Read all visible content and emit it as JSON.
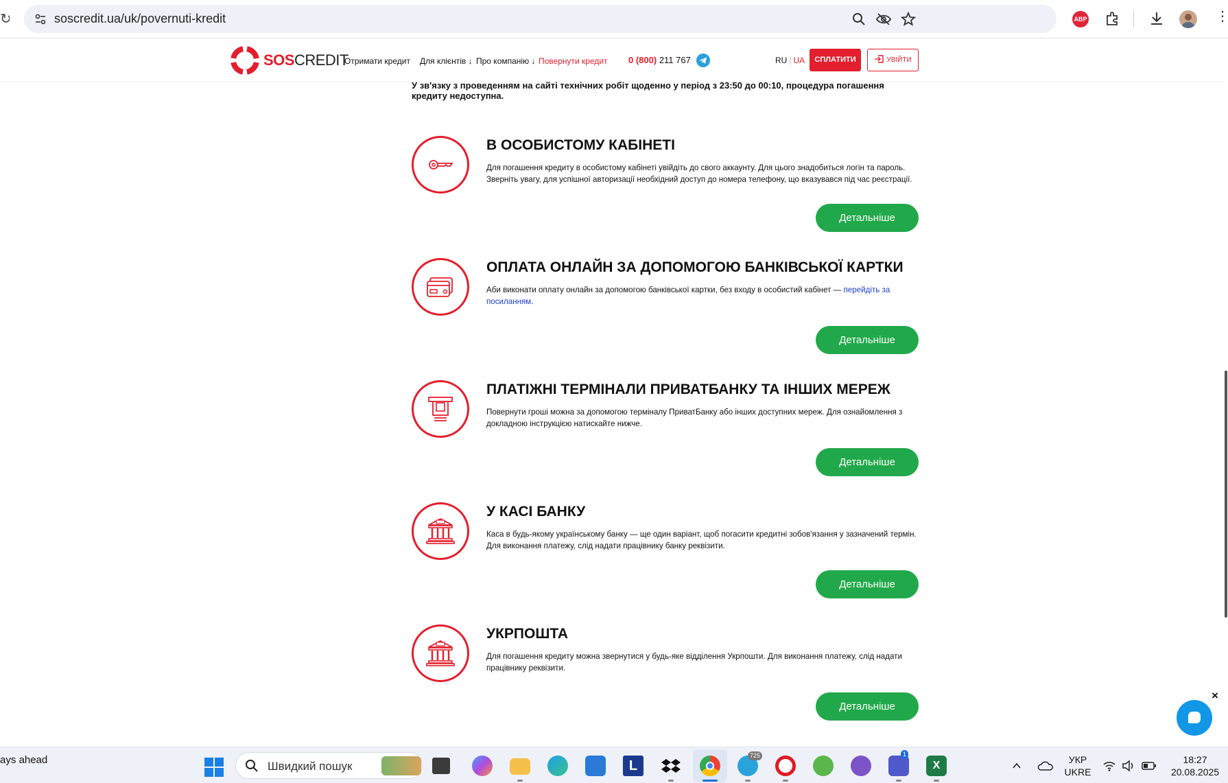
{
  "browser": {
    "url": "soscredit.ua/uk/povernuti-kredit",
    "extension_badge": "ABP"
  },
  "header": {
    "logo_sos": "SOS",
    "logo_credit": "CREDIT",
    "nav": {
      "get_credit": "Отримати кредит",
      "for_clients": "Для клієнтів ↓",
      "about": "Про компанію ↓",
      "return_credit": "Повернути кредит"
    },
    "phone_prefix": "0 (800)",
    "phone_number": " 211 767",
    "lang_ru": "RU",
    "lang_sep": "|",
    "lang_ua": "UA",
    "pay_button": "СПЛАТИТИ",
    "login_button": "УВІЙТИ"
  },
  "notice": "У зв'язку з проведенням на сайті технічних робіт щоденно у період з 23:50 до 00:10, процедура погашення кредиту недоступна.",
  "sections": [
    {
      "icon": "key-icon",
      "title": "В ОСОБИСТОМУ КАБІНЕТІ",
      "text": "Для погашення кредиту в особистому кабінеті увійдіть до свого аккаунту. Для цього знадобиться логін та пароль. Зверніть увагу, для успішної авторизації необхідний доступ до номера телефону, що вказувався під час реєстрації.",
      "button": "Детальніше"
    },
    {
      "icon": "card-icon",
      "title": "ОПЛАТА ОНЛАЙН ЗА ДОПОМОГОЮ БАНКІВСЬКОЇ КАРТКИ",
      "text": "Аби виконати оплату онлайн за допомогою банківської картки, без входу в особистий кабінет — ",
      "link": "перейдіть за посиланням",
      "text_end": ".",
      "button": "Детальніше"
    },
    {
      "icon": "terminal-icon",
      "title": "ПЛАТІЖНІ ТЕРМІНАЛИ ПРИВАТБАНКУ ТА ІНШИХ МЕРЕЖ",
      "text": "Повернути гроші можна за допомогою терміналу ПриватБанку або інших доступних мереж. Для ознайомлення з докладною інструкцією натискайте нижче.",
      "button": "Детальніше"
    },
    {
      "icon": "bank-icon",
      "title": "У КАСІ БАНКУ",
      "text": "Каса в будь-якому українському банку — ще один варіант, щоб погасити кредитні зобов'язання у зазначений термін. Для виконання платежу, слід надати працівнику банку реквізити.",
      "button": "Детальніше"
    },
    {
      "icon": "post-office-icon",
      "title": "УКРПОШТА",
      "text": "Для погашення кредиту можна звернутися у будь-яке відділення Укрпошти. Для виконання платежу, слід надати працівнику реквізити.",
      "button": "Детальніше"
    }
  ],
  "chat": {
    "close": "×"
  },
  "taskbar": {
    "left_text": "ays ahead",
    "search_placeholder": "Швидкий пошук",
    "telegram_badge": "725",
    "teams_badge": "1",
    "lang_top": "УКР",
    "lang_bottom": "UKRE",
    "time": "18:27",
    "date": "20.08.2025"
  },
  "colors": {
    "brand_red": "#e31e2d",
    "button_green": "#21a84a",
    "link_blue": "#1a3fcf",
    "chat_blue": "#1296e6"
  }
}
